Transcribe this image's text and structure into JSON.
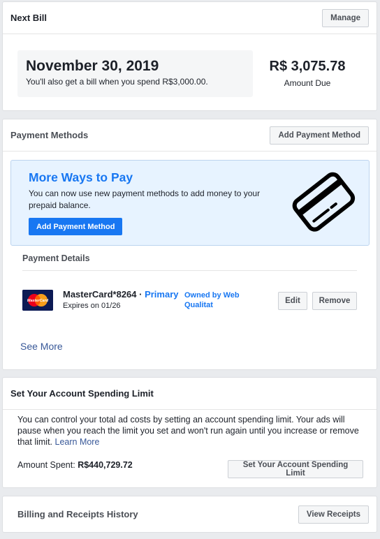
{
  "next_bill": {
    "title": "Next Bill",
    "manage_label": "Manage",
    "date": "November 30, 2019",
    "note": "You'll also get a bill when you spend R$3,000.00.",
    "amount": "R$ 3,075.78",
    "amount_label": "Amount Due"
  },
  "payment_methods": {
    "title": "Payment Methods",
    "add_label": "Add Payment Method",
    "promo": {
      "title": "More Ways to Pay",
      "text": "You can now use new payment methods to add money to your prepaid balance.",
      "button_label": "Add Payment Method",
      "icon": "credit-card-icon"
    },
    "details_title": "Payment Details",
    "card": {
      "brand_logo": "MasterCard",
      "name": "MasterCard*8264",
      "separator": " · ",
      "primary": "Primary",
      "expires": "Expires on 01/26",
      "owned_by": "Owned by Web Qualitat",
      "edit_label": "Edit",
      "remove_label": "Remove"
    },
    "see_more": "See More"
  },
  "spending_limit": {
    "title": "Set Your Account Spending Limit",
    "text": "You can control your total ad costs by setting an account spending limit. Your ads will pause when you reach the limit you set and won't run again until you increase or remove that limit.",
    "learn_more": "Learn More",
    "amount_spent_label": "Amount Spent:",
    "amount_spent_value": "R$440,729.72",
    "button_label": "Set Your Account Spending Limit"
  },
  "billing_history": {
    "title": "Billing and Receipts History",
    "button_label": "View Receipts"
  },
  "colors": {
    "accent": "#1877f2",
    "link": "#385898",
    "promo_bg": "#e7f3ff",
    "page_bg": "#e9ebee"
  }
}
